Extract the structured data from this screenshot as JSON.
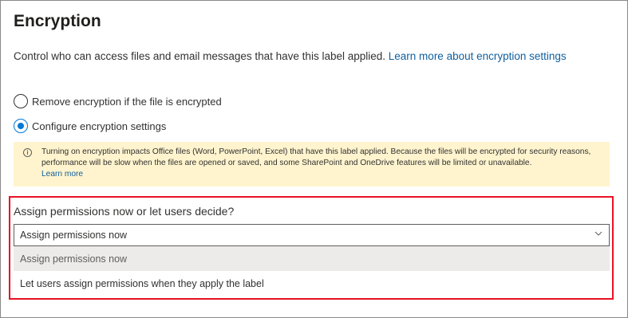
{
  "page": {
    "title": "Encryption",
    "description": "Control who can access files and email messages that have this label applied.",
    "learn_more_link": "Learn more about encryption settings"
  },
  "radio_options": [
    {
      "label": "Remove encryption if the file is encrypted",
      "checked": false
    },
    {
      "label": "Configure encryption settings",
      "checked": true
    }
  ],
  "notice": {
    "icon": "info-icon",
    "text": "Turning on encryption impacts Office files (Word, PowerPoint, Excel) that have this label applied. Because the files will be encrypted for security reasons, performance will be slow when the files are opened or saved, and some SharePoint and OneDrive features will be limited or unavailable.",
    "link": "Learn more"
  },
  "permissions": {
    "question": "Assign permissions now or let users decide?",
    "selected_value": "Assign permissions now",
    "options": [
      "Assign permissions now",
      "Let users assign permissions when they apply the label"
    ]
  },
  "colors": {
    "accent": "#0078d4",
    "link": "#0f5f9e",
    "notice_background": "#fff4ce",
    "highlight_border": "#e81123"
  }
}
